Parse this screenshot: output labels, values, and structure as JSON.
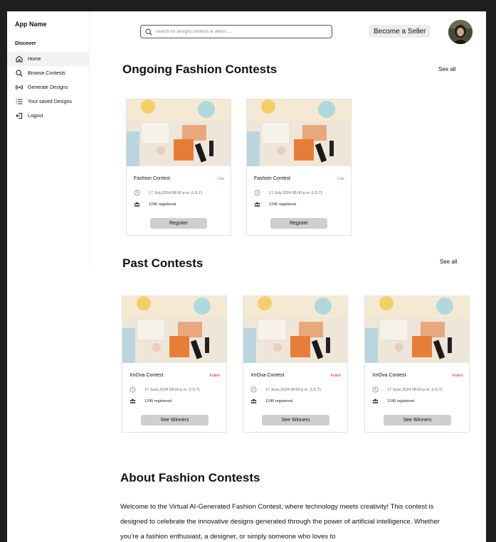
{
  "sidebar": {
    "app_name": "App Name",
    "section_label": "Discover",
    "items": [
      {
        "label": "Home",
        "icon": "home-icon"
      },
      {
        "label": "Browse Contests",
        "icon": "search-icon"
      },
      {
        "label": "Generate Designs",
        "icon": "broadcast-icon"
      },
      {
        "label": "Your saved Designs",
        "icon": "list-icon"
      },
      {
        "label": "Logout",
        "icon": "logout-icon"
      }
    ]
  },
  "header": {
    "search_placeholder": "Search for designs,contests or artists.....",
    "seller_button": "Become a Seller",
    "avatar_icon": "user-avatar"
  },
  "ongoing": {
    "title": "Ongoing Fashion Contests",
    "see_all": "See all",
    "cards": [
      {
        "title": "Fashion Contest",
        "status": "Live",
        "date": "17 July,2024  08:00 p.m. (I.S.T)",
        "registered": "1245 registered",
        "button": "Register"
      },
      {
        "title": "Fashion Contest",
        "status": "Live",
        "date": "17 July,2024  08:00 p.m. (I.S.T)",
        "registered": "1245 registered",
        "button": "Register"
      }
    ]
  },
  "past": {
    "title": "Past Contests",
    "see_all": "See all",
    "cards": [
      {
        "title": "XnOva Contest",
        "status": "Ended",
        "date": "17 June,2024  08:00 p.m. (I.S.T)",
        "registered": "1245 registered",
        "button": "See Winners"
      },
      {
        "title": "XnOva Contest",
        "status": "Ended",
        "date": "17 June,2024  08:00 p.m. (I.S.T)",
        "registered": "1245 registered",
        "button": "See Winners"
      },
      {
        "title": "XnOva Contest",
        "status": "Ended",
        "date": "17 June,2024  08:00 p.m. (I.S.T)",
        "registered": "1245 registered",
        "button": "See Winners"
      }
    ]
  },
  "about": {
    "title": "About Fashion Contests",
    "text": "Welcome to the Virtual AI-Generated Fashion Contest, where technology meets creativity! This contest is designed to celebrate the innovative designs generated through the power of artificial intelligence. Whether you’re a fashion enthusiast, a designer, or simply someone who loves to"
  },
  "colors": {
    "live": "#2db52d",
    "ended": "#e02020",
    "button_bg": "#cfcfcf",
    "page_bg": "#1e1e1e"
  }
}
